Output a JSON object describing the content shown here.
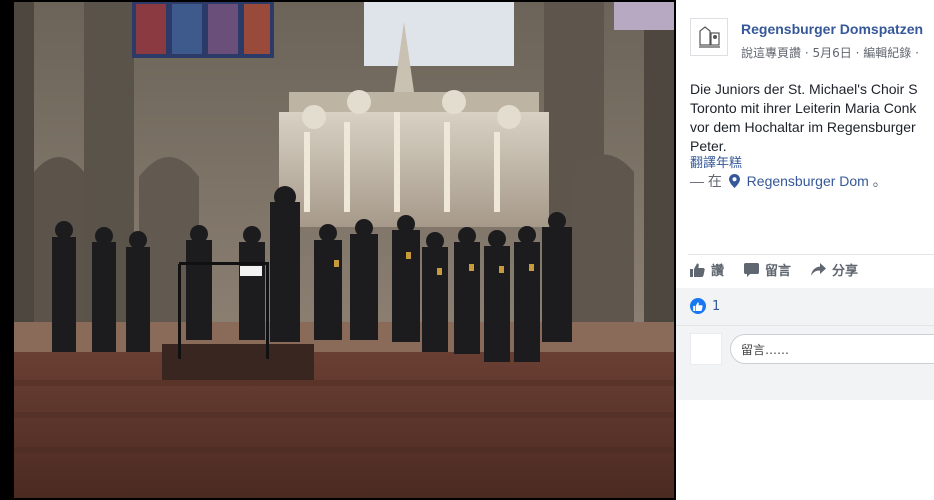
{
  "post": {
    "page_name": "Regensburger Domspatzen",
    "meta": {
      "shared_by": "說這專頁讚",
      "separator": "·",
      "date": "5月6日",
      "edit_history": "編輯紀錄",
      "trailing_dot": "·"
    },
    "text_lines": [
      "Die Juniors der St. Michael's Choir S",
      "Toronto mit ihrer Leiterin Maria Conk",
      "vor dem Hochaltar im Regensburger",
      "Peter."
    ],
    "translate_link": "翻譯年糕",
    "location": {
      "prefix": "— 在",
      "place": "Regensburger Dom",
      "suffix": "。"
    }
  },
  "actions": {
    "like": "讚",
    "comment": "留言",
    "share": "分享"
  },
  "reactions": {
    "count": "1"
  },
  "comment_box": {
    "placeholder": "留言……"
  },
  "colors": {
    "link": "#365899",
    "like_blue": "#1877f2",
    "panel_bg": "#ffffff",
    "muted": "#616770"
  },
  "icons": {
    "avatar": "page-logo-icon",
    "location": "location-pin-icon",
    "like": "thumbs-up-icon",
    "comment": "comment-bubble-icon",
    "share": "share-arrow-icon",
    "reaction": "like-reaction-icon"
  }
}
